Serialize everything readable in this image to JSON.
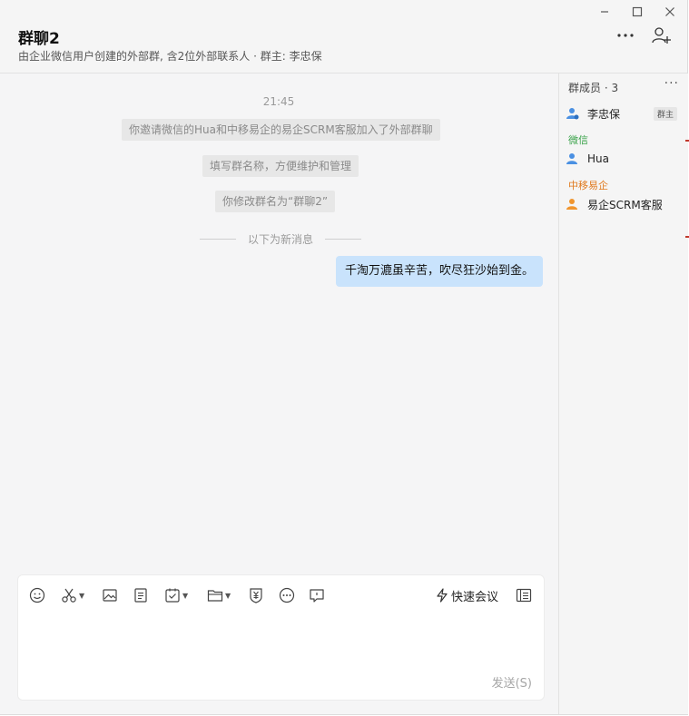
{
  "header": {
    "title": "群聊2",
    "subtitle": "由企业微信用户创建的外部群, 含2位外部联系人 · 群主: 李忠保"
  },
  "window_controls": [
    "minimize-icon",
    "maximize-icon",
    "close-icon"
  ],
  "chat": {
    "time": "21:45",
    "system_messages": [
      "你邀请微信的Hua和中移易企的易企SCRM客服加入了外部群聊",
      "填写群名称，方便维护和管理",
      "你修改群名为“群聊2”"
    ],
    "new_messages_divider": "以下为新消息",
    "messages": [
      {
        "from": "me",
        "text": "千淘万漉虽辛苦，吹尽狂沙始到金。"
      }
    ]
  },
  "composer": {
    "tools": [
      "emoji-icon",
      "screenshot-icon",
      "image-icon",
      "document-icon",
      "task-icon",
      "folder-icon",
      "red-packet-icon",
      "more-icon",
      "quote-icon"
    ],
    "quick_meeting_label": "快速会议",
    "send_label": "发送(S)"
  },
  "sidebar": {
    "title": "群成员 · 3",
    "owner": {
      "name": "李忠保",
      "badge": "群主"
    },
    "groups": [
      {
        "label": "微信",
        "color": "#3aa34a",
        "members": [
          "Hua"
        ]
      },
      {
        "label": "中移易企",
        "color": "#e07a1f",
        "members": [
          "易企SCRM客服"
        ]
      }
    ]
  },
  "colors": {
    "bubble_me": "#c9e3fc",
    "wechat_label": "#3aa34a",
    "company_label": "#e07a1f",
    "member_icon": "#4a90e2"
  }
}
